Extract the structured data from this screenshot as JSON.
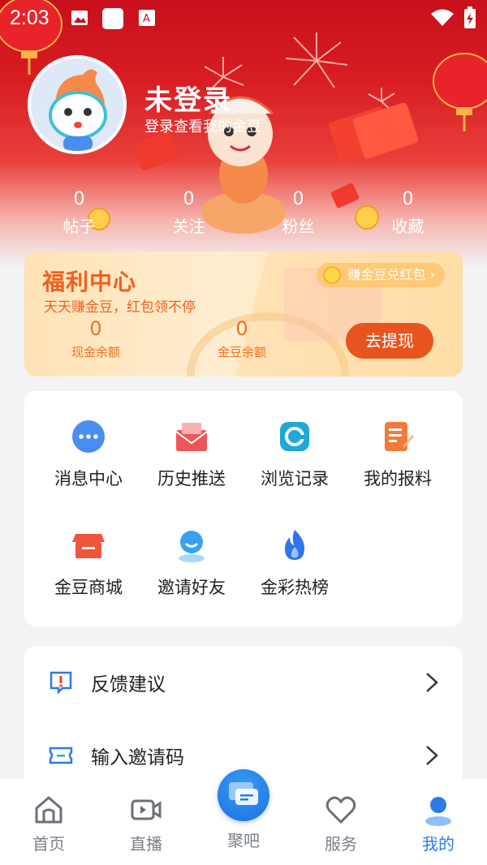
{
  "status_bar": {
    "time": "2:03"
  },
  "profile": {
    "name": "未登录",
    "subtitle": "登录查看我的金豆"
  },
  "stats": [
    {
      "value": "0",
      "label": "帖子"
    },
    {
      "value": "0",
      "label": "关注"
    },
    {
      "value": "0",
      "label": "粉丝"
    },
    {
      "value": "0",
      "label": "收藏"
    }
  ],
  "welfare": {
    "title": "福利中心",
    "subtitle": "天天赚金豆，红包领不停",
    "badge": "赚金豆兑红包",
    "cash_value": "0",
    "cash_label": "现金余额",
    "bean_value": "0",
    "bean_label": "金豆余额",
    "withdraw": "去提现"
  },
  "grid": [
    {
      "label": "消息中心",
      "icon": "message-icon",
      "color": "#4a8df0"
    },
    {
      "label": "历史推送",
      "icon": "push-history-icon",
      "color": "#f0555a"
    },
    {
      "label": "浏览记录",
      "icon": "browse-history-icon",
      "color": "#1fa8d8"
    },
    {
      "label": "我的报料",
      "icon": "report-icon",
      "color": "#f47a3a"
    },
    {
      "label": "金豆商城",
      "icon": "mall-icon",
      "color": "#f0553c"
    },
    {
      "label": "邀请好友",
      "icon": "invite-icon",
      "color": "#3aa0f0"
    },
    {
      "label": "金彩热榜",
      "icon": "hot-list-icon",
      "color": "#2f74e8"
    }
  ],
  "list": [
    {
      "label": "反馈建议",
      "icon": "feedback-icon"
    },
    {
      "label": "输入邀请码",
      "icon": "invite-code-icon"
    }
  ],
  "nav": [
    {
      "label": "首页",
      "icon": "home-icon"
    },
    {
      "label": "直播",
      "icon": "live-icon"
    },
    {
      "label": "聚吧",
      "icon": "chat-bubbles-icon"
    },
    {
      "label": "服务",
      "icon": "heart-icon"
    },
    {
      "label": "我的",
      "icon": "profile-icon",
      "active": true
    }
  ],
  "colors": {
    "accent": "#2a7be6",
    "banner_red": "#d81d22",
    "welfare_orange": "#f06020"
  }
}
